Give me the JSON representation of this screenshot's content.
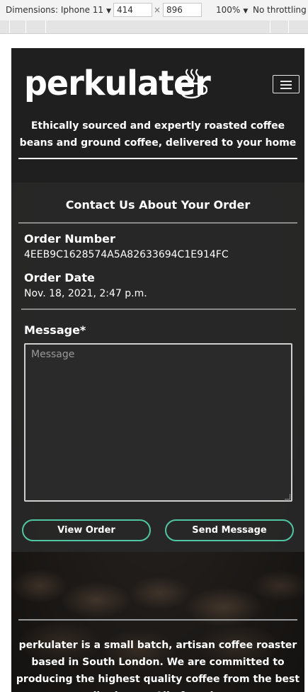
{
  "devtools": {
    "device": "Dimensions: Iphone 11",
    "width": "414",
    "height": "896",
    "separator": "×",
    "zoom": "100%",
    "throttle": "No throttling"
  },
  "header": {
    "logo_text": "perkulater",
    "logo_icon": "coffee-cup-icon",
    "menu_icon": "hamburger-icon",
    "tagline": "Ethically sourced and expertly roasted coffee beans and ground coffee, delivered to your home"
  },
  "contact": {
    "title": "Contact Us About Your Order",
    "order_number_label": "Order Number",
    "order_number": "4EEB9C1628574A5A82633694C1E914FC",
    "order_date_label": "Order Date",
    "order_date": "Nov. 18, 2021, 2:47 p.m.",
    "message_label": "Message*",
    "message_placeholder": "Message",
    "view_order_button": "View Order",
    "send_message_button": "Send Message",
    "accent_color": "#4fc6a1"
  },
  "footer": {
    "text": "perkulater is a small batch, artisan coffee roaster based in South London. We are committed to producing the highest quality coffee from the best quality beans. All of our beans"
  }
}
